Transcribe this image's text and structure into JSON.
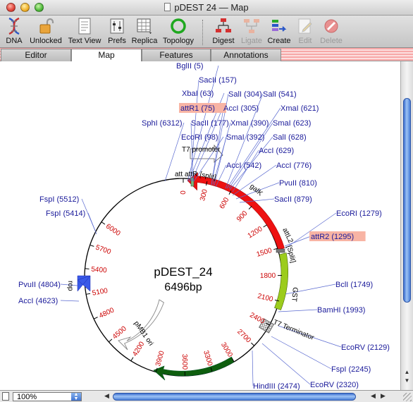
{
  "window": {
    "title": "pDEST 24 — Map"
  },
  "toolbar": {
    "buttons": [
      {
        "label": "DNA"
      },
      {
        "label": "Unlocked"
      },
      {
        "label": "Text View"
      },
      {
        "label": "Prefs"
      },
      {
        "label": "Replica"
      },
      {
        "label": "Topology"
      },
      {
        "label": "Digest"
      },
      {
        "label": "Ligate"
      },
      {
        "label": "Create"
      },
      {
        "label": "Edit"
      },
      {
        "label": "Delete"
      }
    ]
  },
  "tabs": [
    {
      "label": "Editor"
    },
    {
      "label": "Map"
    },
    {
      "label": "Features"
    },
    {
      "label": "Annotations"
    }
  ],
  "active_tab": "Map",
  "map": {
    "name": "pDEST_24",
    "length": "6496bp",
    "ticks": [
      "0",
      "300",
      "600",
      "900",
      "1200",
      "1500",
      "1800",
      "2100",
      "2400",
      "2700",
      "3000",
      "3300",
      "3600",
      "3900",
      "4200",
      "4500",
      "4800",
      "5100",
      "5400",
      "5700",
      "6000"
    ],
    "sites": [
      {
        "label": "BglII (5)"
      },
      {
        "label": "SacII (157)"
      },
      {
        "label": "XbaI (63)"
      },
      {
        "label": "SalI (304)"
      },
      {
        "label": "SalI (541)"
      },
      {
        "label": "attR1 (75)"
      },
      {
        "label": "AccI (305)"
      },
      {
        "label": "XmaI (621)"
      },
      {
        "label": "SacII (177)"
      },
      {
        "label": "XmaI (390)"
      },
      {
        "label": "SmaI (623)"
      },
      {
        "label": "SphI (6312)"
      },
      {
        "label": "EcoRI (98)"
      },
      {
        "label": "SmaI (392)"
      },
      {
        "label": "SalI (628)"
      },
      {
        "label": "AccI (629)"
      },
      {
        "label": "AccI (542)"
      },
      {
        "label": "AccI (776)"
      },
      {
        "label": "PvuII (810)"
      },
      {
        "label": "SacII (879)"
      },
      {
        "label": "EcoRI (1279)"
      },
      {
        "label": "attR2 (1295)"
      },
      {
        "label": "FspI (5512)"
      },
      {
        "label": "FspI (5414)"
      },
      {
        "label": "BclI (1749)"
      },
      {
        "label": "BamHI (1993)"
      },
      {
        "label": "PvuII (4804)"
      },
      {
        "label": "AccI (4623)"
      },
      {
        "label": "EcoRV (2129)"
      },
      {
        "label": "FspI (2245)"
      },
      {
        "label": "EcoRV (2320)"
      },
      {
        "label": "HindIII (2474)"
      }
    ],
    "features": [
      {
        "label": "T7 promoter"
      },
      {
        "label": "att"
      },
      {
        "label": "attR"
      },
      {
        "label": "[split]"
      },
      {
        "label": "galK"
      },
      {
        "label": "attL2"
      },
      {
        "label": "[Split]"
      },
      {
        "label": "GST"
      },
      {
        "label": "T7 Terminator"
      },
      {
        "label": "pMB1 ori"
      },
      {
        "label": "rop"
      }
    ],
    "colors": {
      "ticks": "#cc0000",
      "sites": "#1a1a9a",
      "galK": "#ee1111",
      "GST": "#9ccc1c",
      "ampR": "#0e5e0e",
      "rop": "#3a5ae8",
      "highlight": "#f8b4a4"
    }
  },
  "statusbar": {
    "zoom": "100%"
  }
}
